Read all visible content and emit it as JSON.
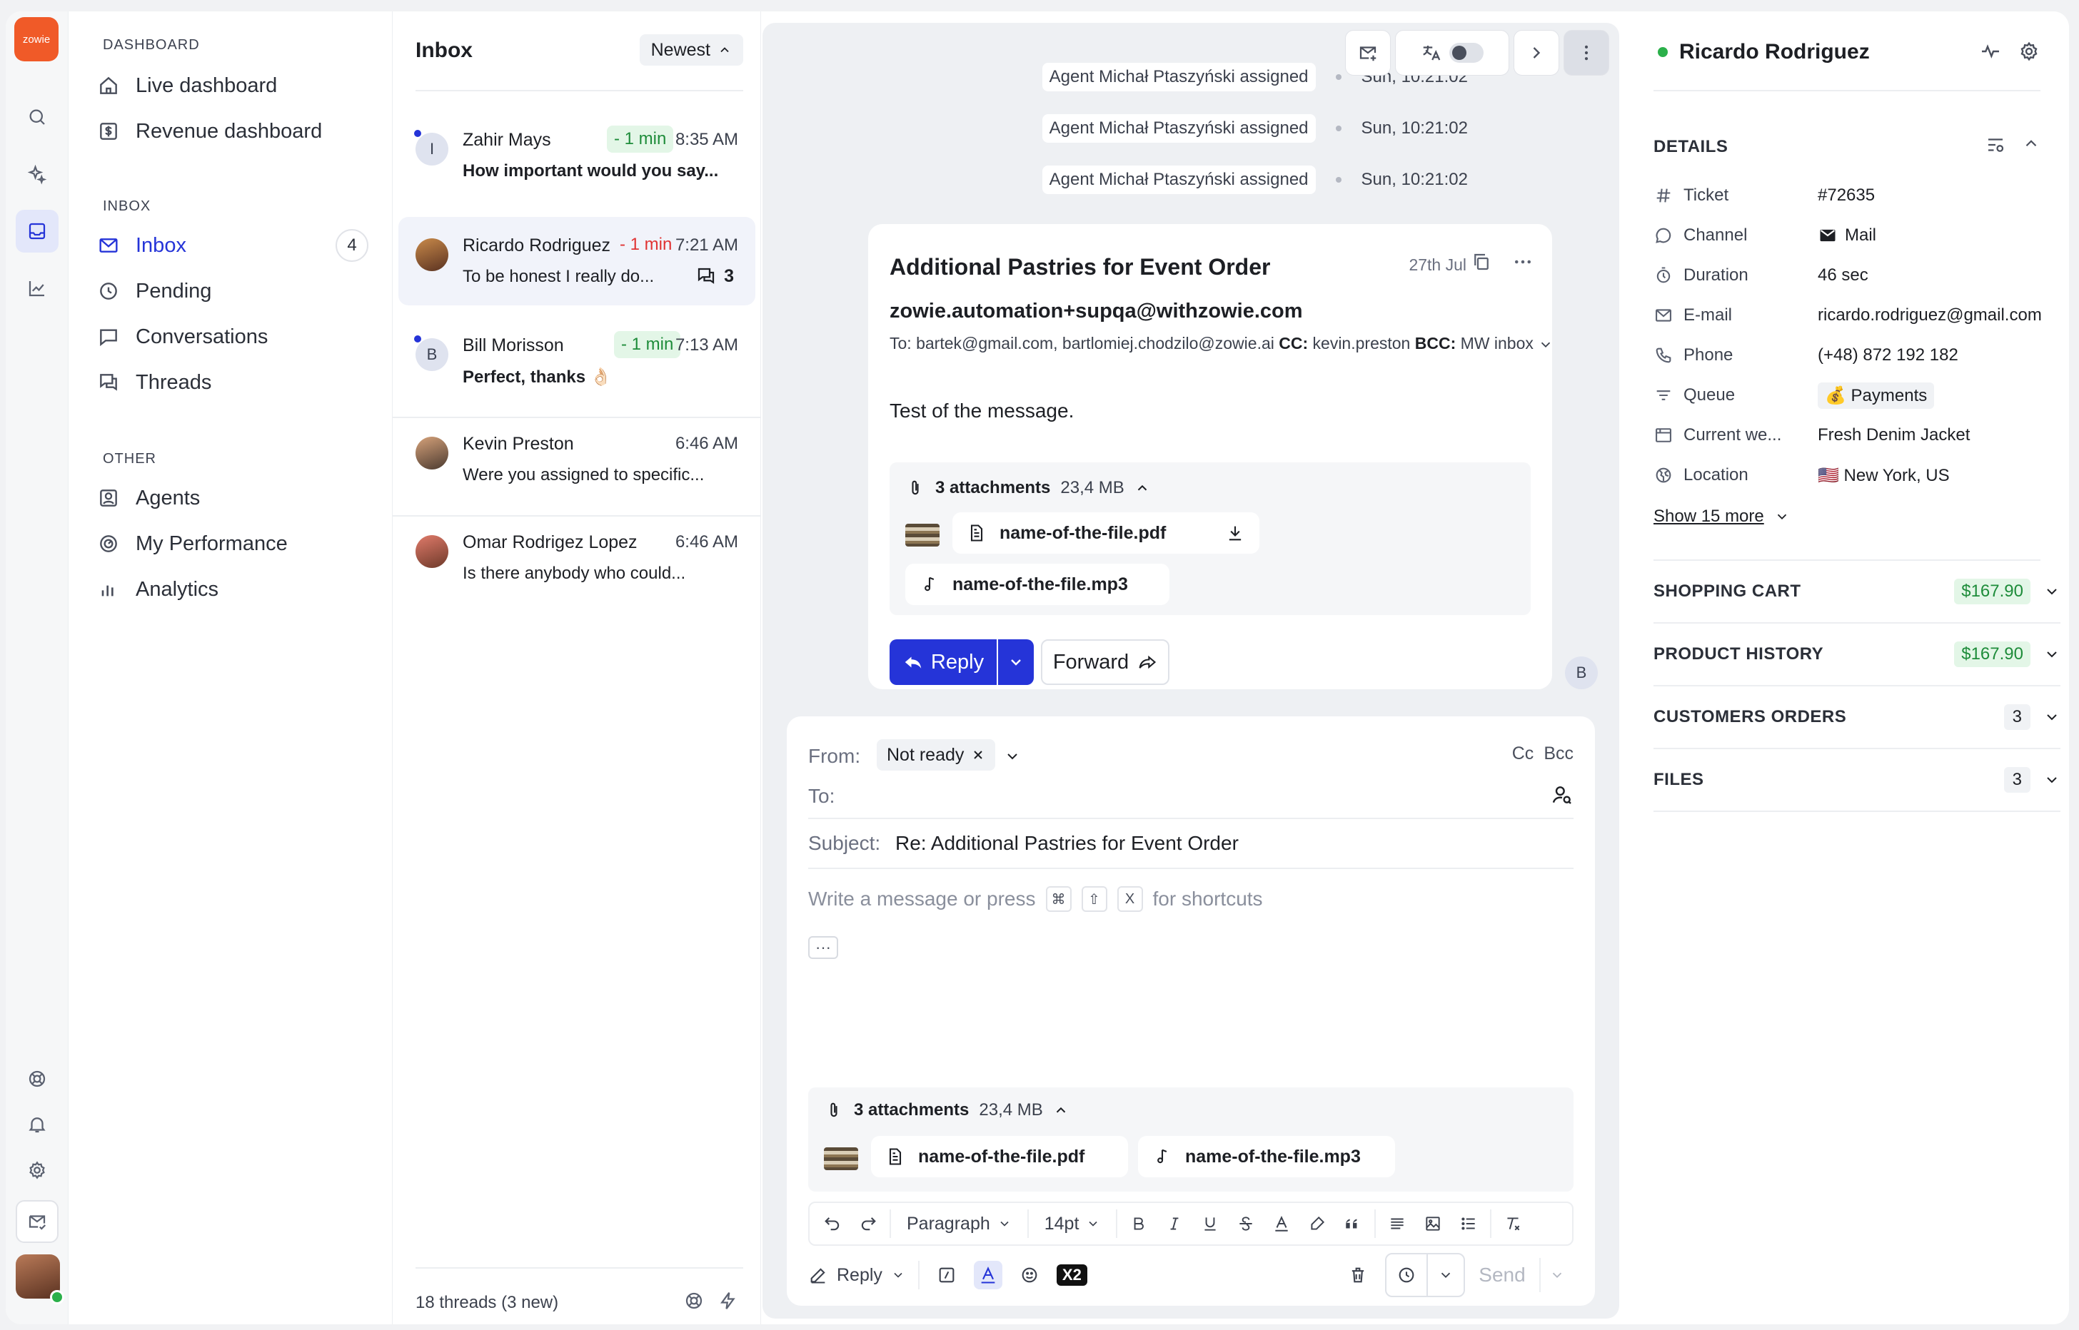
{
  "rail": {
    "logo_text": "zowie",
    "icons": [
      "search-icon",
      "sparkles-icon",
      "inbox-icon",
      "chart-icon",
      "help-icon",
      "bell-icon",
      "settings-icon",
      "mail-check-icon"
    ]
  },
  "nav": {
    "section_dashboard": "DASHBOARD",
    "live_dashboard": "Live dashboard",
    "revenue_dashboard": "Revenue dashboard",
    "section_inbox": "INBOX",
    "inbox": "Inbox",
    "inbox_count": "4",
    "pending": "Pending",
    "conversations": "Conversations",
    "threads": "Threads",
    "section_other": "OTHER",
    "agents": "Agents",
    "my_performance": "My Performance",
    "analytics": "Analytics"
  },
  "list": {
    "title": "Inbox",
    "sort": "Newest",
    "items": [
      {
        "initial": "I",
        "name": "Zahir Mays",
        "tag": "- 1 min",
        "time": "8:35 AM",
        "preview": "How important would you say..."
      },
      {
        "name": "Ricardo Rodriguez",
        "tag": "- 1 min",
        "time": "7:21 AM",
        "preview": "To be honest I really do...",
        "threads": "3"
      },
      {
        "initial": "B",
        "name": "Bill Morisson",
        "tag": "- 1 min",
        "time": "7:13 AM",
        "preview": "Perfect, thanks 👌🏻"
      },
      {
        "name": "Kevin Preston",
        "time": "6:46 AM",
        "preview": "Were you assigned to specific..."
      },
      {
        "name": "Omar Rodrigez Lopez",
        "time": "6:46 AM",
        "preview": "Is there anybody who could..."
      }
    ],
    "footer": "18 threads (3 new)"
  },
  "main": {
    "system_events": [
      {
        "text": "Agent Michał Ptaszyński assigned",
        "time": "Sun, 10:21:02"
      },
      {
        "text": "Agent Michał Ptaszyński assigned",
        "time": "Sun, 10:21:02"
      },
      {
        "text": "Agent Michał Ptaszyński assigned",
        "time": "Sun, 10:21:02"
      }
    ],
    "email": {
      "subject": "Additional Pastries for Event Order",
      "date": "27th Jul",
      "from": "zowie.automation+supqa@withzowie.com",
      "to_label": "To:",
      "to": "bartek@gmail.com, bartlomiej.chodzilo@zowie.ai",
      "cc_label": "CC:",
      "cc": "kevin.preston",
      "bcc_label": "BCC:",
      "bcc": "MW inbox",
      "body": "Test of the message.",
      "attachments_label": "3 attachments",
      "attachments_size": "23,4 MB",
      "file_pdf": "name-of-the-file.pdf",
      "file_mp3": "name-of-the-file.mp3",
      "reply": "Reply",
      "forward": "Forward"
    },
    "agent_initial": "B",
    "composer": {
      "from_label": "From:",
      "from_value": "Not ready",
      "cc": "Cc",
      "bcc": "Bcc",
      "to_label": "To:",
      "subject_label": "Subject:",
      "subject_value": "Re: Additional Pastries for Event Order",
      "placeholder_a": "Write a message or press",
      "key1": "⌘",
      "key2": "⇧",
      "key3": "X",
      "placeholder_b": "for shortcuts",
      "attachments_label": "3 attachments",
      "attachments_size": "23,4 MB",
      "file_pdf": "name-of-the-file.pdf",
      "file_mp3": "name-of-the-file.mp3",
      "paragraph": "Paragraph",
      "font_size": "14pt",
      "mode": "Reply",
      "x2": "X2",
      "send": "Send"
    }
  },
  "details": {
    "name": "Ricardo Rodriguez",
    "section": "DETAILS",
    "rows": [
      {
        "label": "Ticket",
        "value": "#72635"
      },
      {
        "label": "Channel",
        "value": "Mail"
      },
      {
        "label": "Duration",
        "value": "46 sec"
      },
      {
        "label": "E-mail",
        "value": "ricardo.rodriguez@gmail.com"
      },
      {
        "label": "Phone",
        "value": "(+48) 872 192 182"
      },
      {
        "label": "Queue",
        "value": "💰 Payments"
      },
      {
        "label": "Current we...",
        "value": "Fresh Denim Jacket"
      },
      {
        "label": "Location",
        "value": "🇺🇸 New York, US"
      }
    ],
    "show_more": "Show 15 more",
    "accordions": [
      {
        "title": "SHOPPING CART",
        "value": "$167.90"
      },
      {
        "title": "PRODUCT HISTORY",
        "value": "$167.90"
      },
      {
        "title": "CUSTOMERS ORDERS",
        "value": "3"
      },
      {
        "title": "FILES",
        "value": "3"
      }
    ]
  },
  "colors": {
    "accent": "#2534d8",
    "brand": "#f05a28",
    "success": "#2bb04a",
    "danger": "#e03333"
  }
}
